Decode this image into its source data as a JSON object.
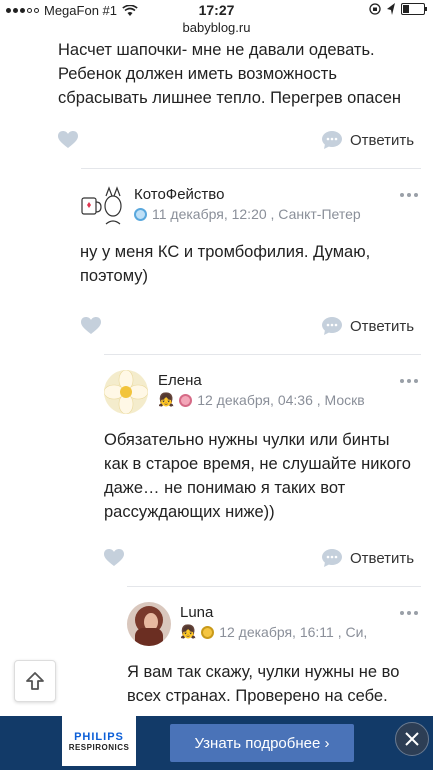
{
  "status_bar": {
    "carrier": "MegaFon #1",
    "time": "17:27",
    "url": "babyblog.ru"
  },
  "prev_comment": {
    "lines": [
      "Насчет шапочки- мне не давали одевать.",
      "Ребенок должен иметь возможность",
      "сбрасывать лишнее тепло. Перегрев опасен"
    ],
    "reply_label": "Ответить"
  },
  "comments": [
    {
      "author": "КотоФейство",
      "meta": "11 декабря, 12:20 , Санкт-Петер",
      "status_color": "#5aa8dd",
      "lines": [
        "ну у меня КС и тромбофилия. Думаю,",
        "поэтому)"
      ],
      "reply_label": "Ответить"
    },
    {
      "author": "Елена",
      "meta": "12 декабря, 04:36 , Москв",
      "status_color": "#d56a86",
      "lines": [
        "Обязательно нужны чулки или бинты",
        "как в старое время, не слушайте никого",
        "даже… не понимаю я таких вот",
        "рассуждающих ниже))"
      ],
      "reply_label": "Ответить"
    },
    {
      "author": "Luna",
      "meta": "12 декабря, 16:11 , Си,",
      "status_color": "#c99a1a",
      "lines": [
        "Я вам так скажу, чулки нужны не во",
        "всех странах. Проверено на себе."
      ]
    }
  ],
  "ad": {
    "brand": "PHILIPS",
    "sub_brand": "RESPIRONICS",
    "cta": "Узнать подробнее ›"
  }
}
